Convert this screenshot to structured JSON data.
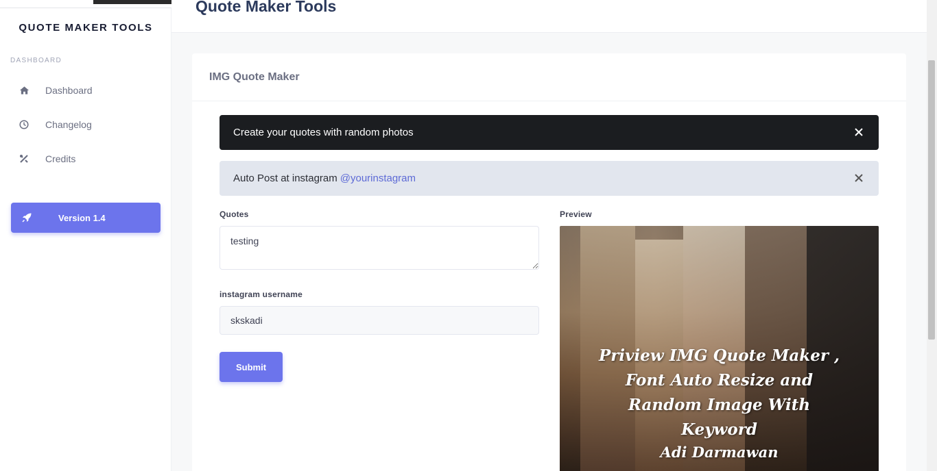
{
  "app": {
    "brand": "QUOTE MAKER TOOLS",
    "page_title": "Quote Maker Tools"
  },
  "sidebar": {
    "section_label": "DASHBOARD",
    "items": [
      {
        "label": "Dashboard",
        "icon": "home-icon"
      },
      {
        "label": "Changelog",
        "icon": "clock-icon"
      },
      {
        "label": "Credits",
        "icon": "tools-icon"
      }
    ],
    "version_button": {
      "label": "Version 1.4",
      "icon": "rocket-icon"
    }
  },
  "card": {
    "title": "IMG Quote Maker",
    "alerts": [
      {
        "text": "Create your quotes with random photos"
      },
      {
        "text": "Auto Post at instagram",
        "link": "@yourinstagram"
      }
    ],
    "form": {
      "quotes_label": "Quotes",
      "quotes_value": "testing",
      "instagram_label": "instagram username",
      "instagram_value": "skskadi",
      "submit_label": "Submit"
    },
    "preview": {
      "label": "Preview",
      "quote_text": "Priview IMG Quote Maker , Font Auto Resize and Random Image With Keyword",
      "author": "Adi Darmawan"
    }
  },
  "colors": {
    "accent": "#6c74ec",
    "alert_dark": "#1b1d20",
    "alert_light": "#e2e6ee",
    "link": "#5d6ad6"
  }
}
